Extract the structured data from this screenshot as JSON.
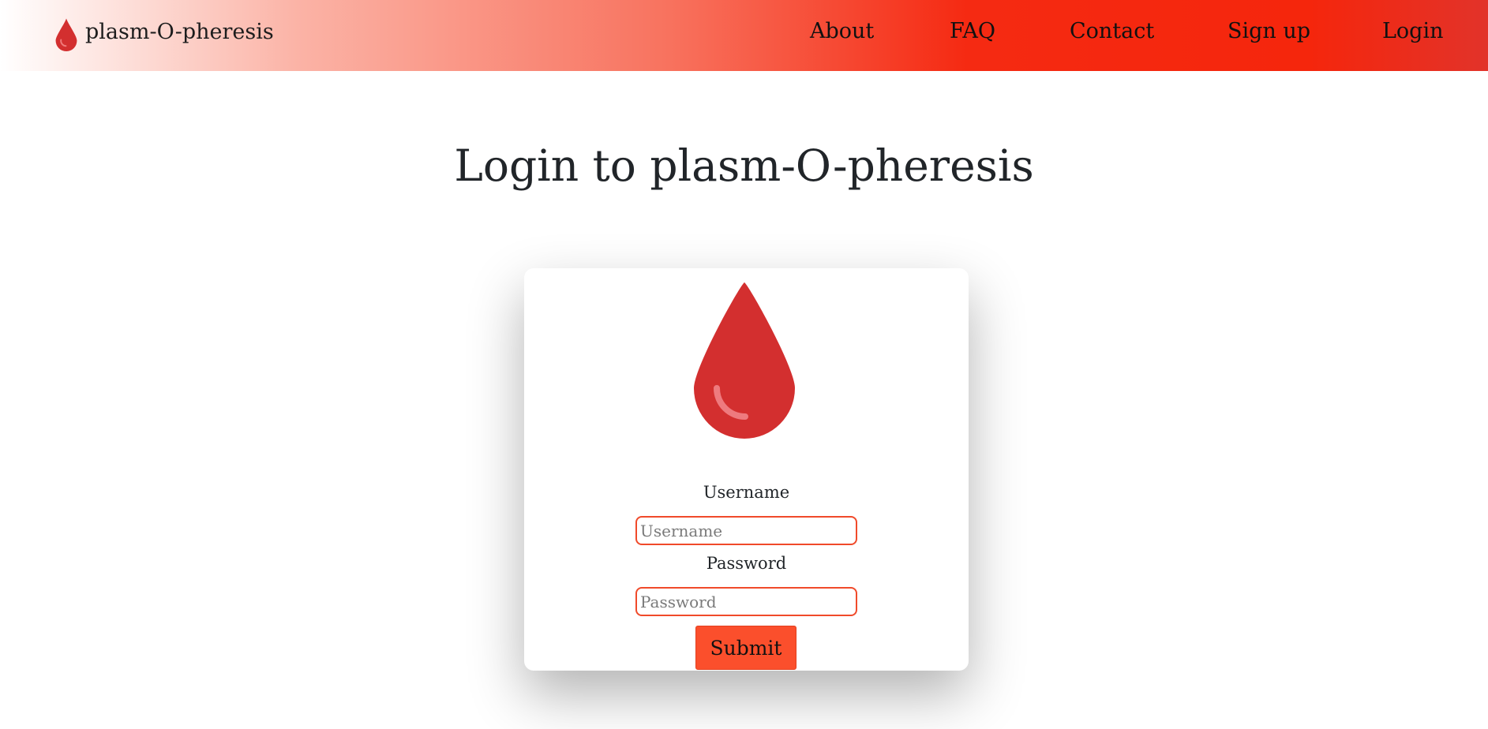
{
  "brand": {
    "name": "plasm-O-pheresis",
    "icon": "blood-drop-icon"
  },
  "nav": {
    "items": [
      {
        "label": "About"
      },
      {
        "label": "FAQ"
      },
      {
        "label": "Contact"
      },
      {
        "label": "Sign up"
      },
      {
        "label": "Login"
      }
    ]
  },
  "page": {
    "title": "Login to plasm-O-pheresis"
  },
  "login_form": {
    "icon": "blood-drop-icon",
    "username": {
      "label": "Username",
      "placeholder": "Username",
      "value": ""
    },
    "password": {
      "label": "Password",
      "placeholder": "Password",
      "value": ""
    },
    "submit_label": "Submit"
  },
  "colors": {
    "accent": "#fb4f2c",
    "drop": "#d32f2f",
    "input_border": "#f04a2a"
  }
}
